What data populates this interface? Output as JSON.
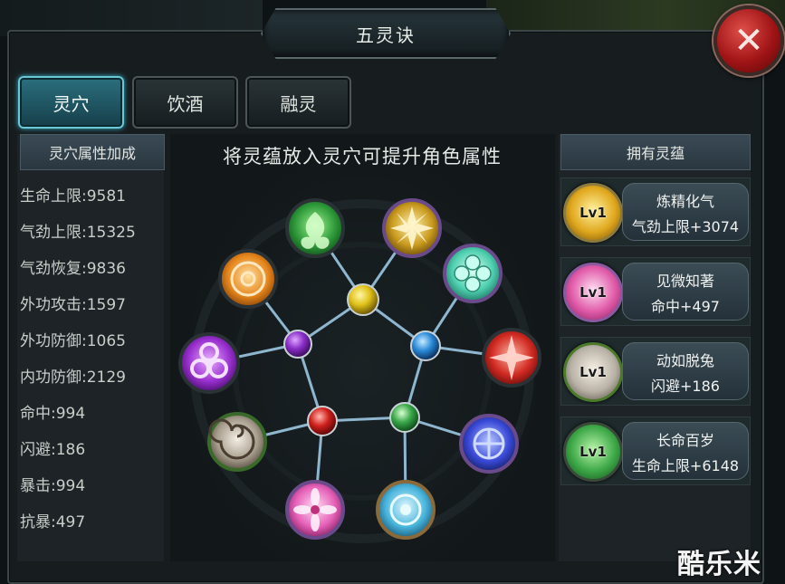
{
  "window": {
    "title": "五灵诀",
    "close_label": "✕"
  },
  "tabs": [
    {
      "label": "灵穴",
      "active": true
    },
    {
      "label": "饮酒",
      "active": false
    },
    {
      "label": "融灵",
      "active": false
    }
  ],
  "left_panel": {
    "header": "灵穴属性加成",
    "stats": [
      "生命上限:9581",
      "气劲上限:15325",
      "气劲恢复:9836",
      "外功攻击:1597",
      "外功防御:1065",
      "内功防御:2129",
      "命中:994",
      "闪避:186",
      "暴击:994",
      "抗暴:497"
    ]
  },
  "center": {
    "title": "将灵蕴放入灵穴可提升角色属性"
  },
  "right_panel": {
    "header": "拥有灵蕴",
    "items": [
      {
        "level": "Lv1",
        "name": "炼精化气",
        "effect": "气劲上限+3074",
        "color": "#d9a21e",
        "icon": "flame-icon"
      },
      {
        "level": "Lv1",
        "name": "见微知著",
        "effect": "命中+497",
        "color": "#e05aa8",
        "icon": "lotus-icon"
      },
      {
        "level": "Lv1",
        "name": "动如脱兔",
        "effect": "闪避+186",
        "color": "#b9b2a6",
        "icon": "swirl-icon"
      },
      {
        "level": "Lv1",
        "name": "长命百岁",
        "effect": "生命上限+6148",
        "color": "#3ea848",
        "icon": "leaf-icon"
      }
    ]
  },
  "watermark": "酷乐米",
  "colors": {
    "accent": "#3ab0c6",
    "close": "#a01416",
    "link_line": "#8fb6cf"
  }
}
